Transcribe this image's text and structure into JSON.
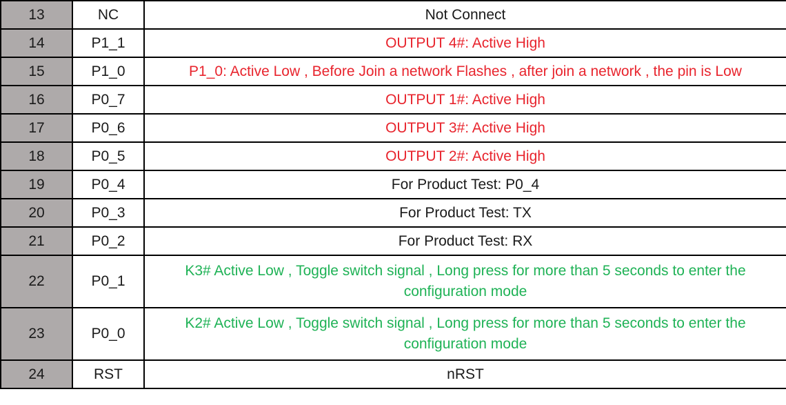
{
  "colors": {
    "number_cell_bg": "#aeaaaa",
    "red_text": "#e8242d",
    "green_text": "#1fb256",
    "default_text": "#1a1a1a"
  },
  "rows": [
    {
      "num": "13",
      "pin": "NC",
      "desc": "Not Connect",
      "color": "dark",
      "tall": false
    },
    {
      "num": "14",
      "pin": "P1_1",
      "desc": "OUTPUT 4#:  Active High",
      "color": "red",
      "tall": false
    },
    {
      "num": "15",
      "pin": "P1_0",
      "desc": "P1_0:  Active Low , Before Join a network Flashes , after join a network , the pin is Low",
      "color": "red",
      "tall": false
    },
    {
      "num": "16",
      "pin": "P0_7",
      "desc": "OUTPUT 1#:  Active High",
      "color": "red",
      "tall": false
    },
    {
      "num": "17",
      "pin": "P0_6",
      "desc": "OUTPUT 3#:  Active High",
      "color": "red",
      "tall": false
    },
    {
      "num": "18",
      "pin": "P0_5",
      "desc": "OUTPUT 2#:  Active High",
      "color": "red",
      "tall": false
    },
    {
      "num": "19",
      "pin": "P0_4",
      "desc": "For Product Test:  P0_4",
      "color": "dark",
      "tall": false
    },
    {
      "num": "20",
      "pin": "P0_3",
      "desc": "For Product Test:  TX",
      "color": "dark",
      "tall": false
    },
    {
      "num": "21",
      "pin": "P0_2",
      "desc": "For Product Test:  RX",
      "color": "dark",
      "tall": false
    },
    {
      "num": "22",
      "pin": "P0_1",
      "desc": "K3# Active Low , Toggle switch signal , Long press for more than 5 seconds to enter the configuration mode",
      "color": "green",
      "tall": true
    },
    {
      "num": "23",
      "pin": "P0_0",
      "desc": "K2# Active Low , Toggle switch signal , Long press for more than 5 seconds to enter the configuration mode",
      "color": "green",
      "tall": true
    },
    {
      "num": "24",
      "pin": "RST",
      "desc": "nRST",
      "color": "dark",
      "tall": false
    }
  ]
}
